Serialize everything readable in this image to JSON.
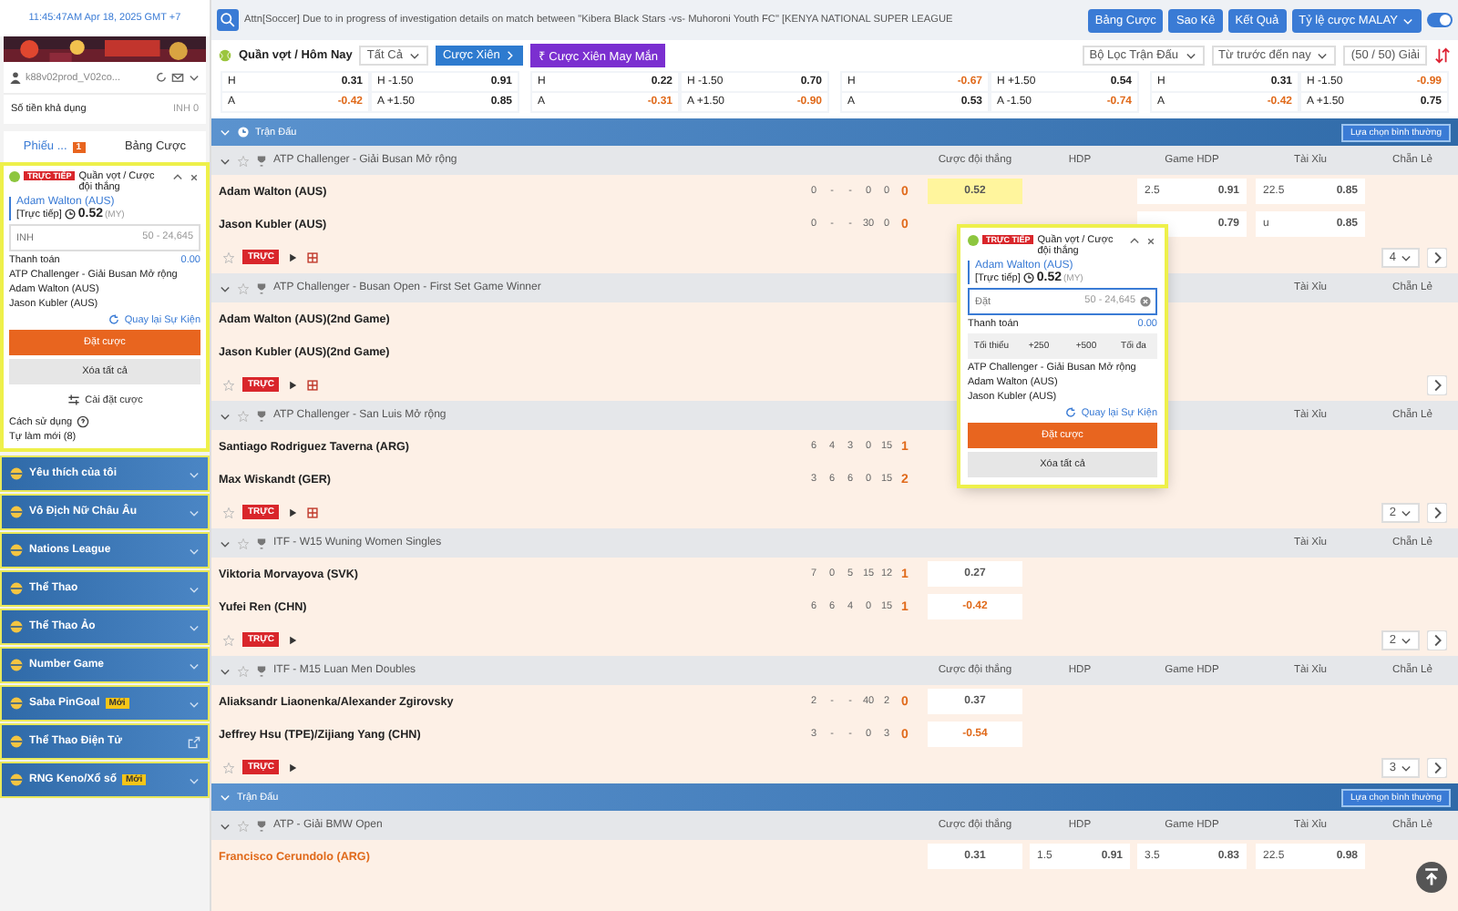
{
  "sidebar": {
    "clock": "11:45:47AM Apr 18, 2025 GMT +7",
    "user": "k88v02prod_V02co...",
    "balance": {
      "label": "Số tiền khả dụng",
      "value": "INH 0"
    },
    "tabs": [
      {
        "label": "Phiếu ...",
        "badge": "1",
        "selected": true
      },
      {
        "label": "Bảng Cược",
        "selected": false
      }
    ],
    "slip": {
      "badge": "TRỰC TIẾP",
      "market": "Quần vợt / Cược đội thắng",
      "selection": "Adam Walton (AUS)",
      "price_label": "[Trực tiếp]",
      "price": "0.52",
      "odds_type": "(MY)",
      "stake": {
        "placeholder": "INH",
        "range": "50 - 24,645"
      },
      "payout": {
        "label": "Thanh toán",
        "value": "0.00"
      },
      "event": [
        "ATP Challenger - Giải Busan Mở rộng",
        "Adam Walton (AUS)",
        "Jason Kubler (AUS)"
      ],
      "back_link": "Quay lại Sự Kiện",
      "place": "Đặt cược",
      "clear": "Xóa tất cả",
      "settings": "Cài đặt cược"
    },
    "help": "Cách sử dụng",
    "refresh": "Tự làm mới (8)",
    "menu": [
      {
        "label": "Yêu thích của tôi",
        "kind": "menu"
      },
      {
        "label": "Vô Địch Nữ Châu Âu",
        "kind": "menu"
      },
      {
        "label": "Nations League",
        "kind": "menu"
      },
      {
        "label": "Thể Thao",
        "kind": "menu"
      },
      {
        "label": "Thể Thao Ảo",
        "kind": "menu"
      },
      {
        "label": "Number Game",
        "kind": "menu"
      },
      {
        "label": "Saba PinGoal",
        "badge": "Mới",
        "kind": "menu"
      },
      {
        "label": "Thể Thao Điện Tử",
        "kind": "link"
      },
      {
        "label": "RNG Keno/Xổ số",
        "badge": "Mới",
        "kind": "menu"
      }
    ]
  },
  "topbar": {
    "notice": "Attn[Soccer] Due to in progress of investigation details on match between \"Kibera Black Stars -vs- Muhoroni Youth FC\" [KENYA NATIONAL SUPER LEAGUE",
    "buttons": [
      "Bảng Cược",
      "Sao Kê",
      "Kết Quả"
    ],
    "odds_menu": "Tỷ lệ cược MALAY",
    "toggle": {
      "on": true
    }
  },
  "filters": {
    "sport": "Quần vợt / Hôm Nay",
    "scope": "Tất Cả",
    "parlay": "Cược Xiên",
    "lucky": "₹ Cược Xiên May Mắn",
    "match_filter": "Bộ Lọc Trận Đấu",
    "period": "Từ trước đến nay",
    "leagues": "(50 / 50) Giải"
  },
  "cards": [
    {
      "rows": [
        {
          "side": "H",
          "price": "0.31",
          "handicap": "H -1.50",
          "handicap_price": "0.91"
        },
        {
          "side": "A",
          "price": "-0.42",
          "handicap": "A +1.50",
          "handicap_price": "0.85"
        }
      ]
    },
    {
      "rows": [
        {
          "side": "H",
          "price": "0.22",
          "handicap": "H -1.50",
          "handicap_price": "0.70"
        },
        {
          "side": "A",
          "price": "-0.31",
          "handicap": "A +1.50",
          "handicap_price": "-0.90"
        }
      ]
    },
    {
      "rows": [
        {
          "side": "H",
          "price": "-0.67",
          "handicap": "H +1.50",
          "handicap_price": "0.54"
        },
        {
          "side": "A",
          "price": "0.53",
          "handicap": "A -1.50",
          "handicap_price": "-0.74"
        }
      ]
    },
    {
      "rows": [
        {
          "side": "H",
          "price": "0.31",
          "handicap": "H -1.50",
          "handicap_price": "-0.99"
        },
        {
          "side": "A",
          "price": "-0.42",
          "handicap": "A +1.50",
          "handicap_price": "0.75"
        }
      ]
    }
  ],
  "sections": [
    {
      "title": "Trận Đấu",
      "option": "Lựa chọn bình thường",
      "leagues": [
        {
          "name": "ATP Challenger - Giải Busan Mở rộng",
          "columns": [
            "Cược đội thắng",
            "HDP",
            "Game HDP",
            "Tài Xỉu",
            "Chẵn Lẻ"
          ],
          "players": [
            {
              "name": "Adam Walton (AUS)",
              "highlighted": false,
              "scores": [
                "0",
                "-",
                "-",
                "0",
                "0",
                "0"
              ],
              "odds": {
                "win": {
                  "price": "0.52",
                  "selected": true
                },
                "game_hdp": {
                  "line": "2.5",
                  "price": "0.91"
                },
                "total": {
                  "line": "22.5",
                  "price": "0.85"
                }
              }
            },
            {
              "name": "Jason Kubler (AUS)",
              "highlighted": false,
              "scores": [
                "0",
                "-",
                "-",
                "30",
                "0",
                "0"
              ],
              "odds": {
                "game_hdp": {
                  "price": "0.79"
                },
                "total": {
                  "line": "u",
                  "price": "0.85"
                }
              }
            }
          ],
          "footer": {
            "badge": "TRỰC",
            "stats": true,
            "pager": "4"
          }
        },
        {
          "name": "ATP Challenger - Busan Open - First Set Game Winner",
          "columns": [
            "Tài Xỉu",
            "Chẵn Lẻ"
          ],
          "players": [
            {
              "name": "Adam Walton (AUS)(2nd Game)",
              "highlighted": false
            },
            {
              "name": "Jason Kubler (AUS)(2nd Game)",
              "highlighted": false
            }
          ],
          "footer": {
            "badge": "TRỰC",
            "stats": true
          }
        },
        {
          "name": "ATP Challenger - San Luis Mở rộng",
          "columns": [
            "Tài Xỉu",
            "Chẵn Lẻ"
          ],
          "players": [
            {
              "name": "Santiago Rodriguez Taverna (ARG)",
              "highlighted": false,
              "scores": [
                "6",
                "4",
                "3",
                "0",
                "15",
                "1"
              ]
            },
            {
              "name": "Max Wiskandt (GER)",
              "highlighted": false,
              "scores": [
                "3",
                "6",
                "6",
                "0",
                "15",
                "2"
              ]
            }
          ],
          "footer": {
            "badge": "TRỰC",
            "stats": true,
            "pager": "2"
          }
        },
        {
          "name": "ITF - W15 Wuning Women Singles",
          "columns": [
            "Tài Xỉu",
            "Chẵn Lẻ"
          ],
          "players": [
            {
              "name": "Viktoria Morvayova (SVK)",
              "highlighted": false,
              "scores": [
                "7",
                "0",
                "5",
                "15",
                "12",
                "1"
              ],
              "odds": {
                "win": {
                  "price": "0.27",
                  "selected": false
                }
              }
            },
            {
              "name": "Yufei Ren (CHN)",
              "highlighted": false,
              "scores": [
                "6",
                "6",
                "4",
                "0",
                "15",
                "1"
              ],
              "odds": {
                "win": {
                  "price": "-0.42",
                  "selected": false
                }
              }
            }
          ],
          "footer": {
            "badge": "TRỰC",
            "stats": false,
            "pager": "2"
          }
        },
        {
          "name": "ITF - M15 Luan Men Doubles",
          "columns": [
            "Cược đội thắng",
            "HDP",
            "Game HDP",
            "Tài Xỉu",
            "Chẵn Lẻ"
          ],
          "players": [
            {
              "name": "Aliaksandr Liaonenka/Alexander Zgirovsky",
              "highlighted": false,
              "scores": [
                "2",
                "-",
                "-",
                "40",
                "2",
                "0"
              ],
              "odds": {
                "win": {
                  "price": "0.37",
                  "selected": false
                }
              }
            },
            {
              "name": "Jeffrey Hsu (TPE)/Zijiang Yang (CHN)",
              "highlighted": false,
              "scores": [
                "3",
                "-",
                "-",
                "0",
                "3",
                "0"
              ],
              "odds": {
                "win": {
                  "price": "-0.54",
                  "selected": false
                }
              }
            }
          ],
          "footer": {
            "badge": "TRỰC",
            "stats": false,
            "pager": "3"
          }
        }
      ]
    },
    {
      "title": "Trận Đấu",
      "option": "Lựa chọn bình thường",
      "leagues": [
        {
          "name": "ATP - Giải BMW Open",
          "columns": [
            "Cược đội thắng",
            "HDP",
            "Game HDP",
            "Tài Xỉu",
            "Chẵn Lẻ"
          ],
          "players": [
            {
              "name": "Francisco Cerundolo (ARG)",
              "highlighted": true,
              "odds": {
                "win": {
                  "price": "0.31",
                  "selected": false
                },
                "hdp": {
                  "line": "1.5",
                  "price": "0.91"
                },
                "game_hdp": {
                  "line": "3.5",
                  "price": "0.83"
                },
                "total": {
                  "line": "22.5",
                  "price": "0.98"
                }
              }
            }
          ]
        }
      ]
    }
  ],
  "popup": {
    "badge": "TRỰC TIẾP",
    "market": "Quần vợt / Cược đội thắng",
    "selection": "Adam Walton (AUS)",
    "price_label": "[Trực tiếp]",
    "price": "0.52",
    "odds_type": "(MY)",
    "stake": {
      "placeholder": "Đặt",
      "range": "50 - 24,645"
    },
    "payout": {
      "label": "Thanh toán",
      "value": "0.00"
    },
    "quick": [
      "Tối thiểu",
      "+250",
      "+500",
      "Tối đa"
    ],
    "event": [
      "ATP Challenger - Giải Busan Mở rộng",
      "Adam Walton (AUS)",
      "Jason Kubler (AUS)"
    ],
    "back_link": "Quay lại Sự Kiện",
    "place": "Đặt cược",
    "clear": "Xóa tất cả"
  }
}
